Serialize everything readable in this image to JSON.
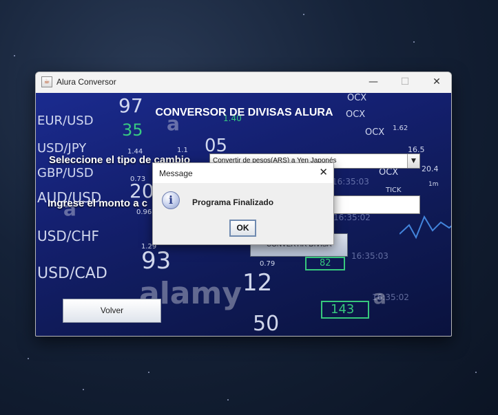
{
  "window": {
    "title": "Alura Conversor",
    "app_icon": "java-coffee-icon",
    "controls": {
      "minimize": "—",
      "maximize": "☐",
      "close": "✕"
    }
  },
  "form": {
    "heading": "CONVERSOR DE DIVISAS ALURA",
    "type_label": "Seleccione el tipo de cambio",
    "type_selected": "Convertir de pesos(ARS) a Yen Japonés",
    "amount_label": "Ingrese el monto a c",
    "amount_value": "",
    "convert_button": "CONVERTIR DIVISA",
    "back_button": "Volver"
  },
  "background": {
    "pairs": [
      "EUR/USD",
      "USD/JPY",
      "GBP/USD",
      "AUD/USD",
      "USD/CHF",
      "USD/CAD"
    ],
    "numbers": [
      "97",
      "35",
      "05",
      "20",
      "93",
      "12",
      "50",
      "1.44",
      "1.29",
      "0.73",
      "0.79",
      "0.96",
      "1.40",
      "1.62",
      "1.1",
      "20.4",
      "16.5",
      "82",
      "143",
      "1m"
    ],
    "tickers": [
      "OCX",
      "TICK"
    ],
    "times": [
      "16:35:03",
      "16:35:02",
      "16:35:03",
      "16:35:02"
    ],
    "watermark": "alamy"
  },
  "dialog": {
    "title": "Message",
    "message": "Programa Finalizado",
    "ok_button": "OK",
    "icon": "info-icon"
  }
}
